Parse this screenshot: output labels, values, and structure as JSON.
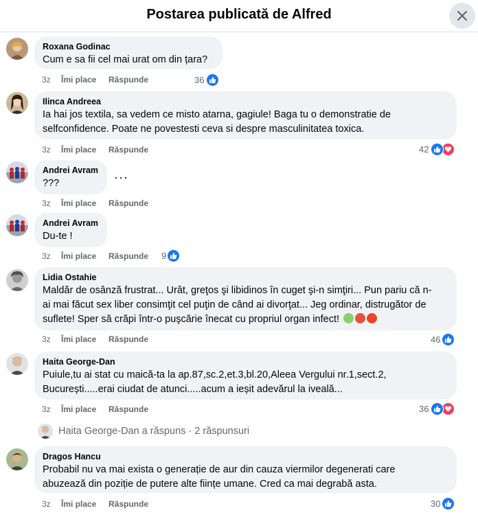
{
  "header": {
    "title": "Postarea publicată de Alfred"
  },
  "actions": {
    "like": "Îmi place",
    "reply": "Răspunde"
  },
  "comments": [
    {
      "author": "Roxana Godinac",
      "text": "Cum e sa fii cel mai urat om din țara?",
      "time": "3z",
      "count": "36"
    },
    {
      "author": "Ilinca Andreea",
      "text_lines": [
        "Ia hai jos textila, sa vedem ce misto atarna, gagiule! Baga tu o demonstratie de",
        "selfconfidence. Poate ne povestesti ceva si despre masculinitatea toxica."
      ],
      "time": "3z",
      "count": "42"
    },
    {
      "author": "Andrei Avram",
      "text": "???",
      "time": "3z",
      "more": "···"
    },
    {
      "author": "Andrei Avram",
      "text": "Du-te !",
      "time": "3z",
      "count": "9"
    },
    {
      "author": "Lidia Ostahie",
      "text_lines": [
        "Maldăr de osânză frustrat... Urât, greţos şi libidinos în cuget şi-n simţiri... Pun pariu că n-",
        "ai mai făcut sex liber consimţit cel puţin de când ai divorţat... Jeg ordinar, distrugător de",
        "suflete! Sper să crăpi într-o puşcărie înecat cu propriul organ infect!"
      ],
      "time": "3z",
      "count": "46"
    },
    {
      "author": "Haita George-Dan",
      "text_lines": [
        "Puiule,tu ai stat cu maică-ta la ap.87,sc.2,et.3,bl.20,Aleea Vergului nr.1,sect.2,",
        "București.....erai ciudat de atunci.....acum a ieșit adevărul la iveală..."
      ],
      "time": "3z",
      "count": "36"
    },
    {
      "author": "Dragos Hancu",
      "text_lines": [
        "Probabil nu va mai exista o generație de aur din cauza viermilor degenerati care",
        "abuzează din poziție de putere alte ființe umane. Cred ca mai degrabă asta."
      ],
      "time": "3z",
      "count": "30"
    }
  ],
  "reply_summary": "Haita George-Dan a răspuns · 2 răspunsuri",
  "colors": {
    "like": "#1877f2",
    "love": "#f33e58",
    "bubble": "#f0f2f5",
    "meta": "#65676b"
  }
}
